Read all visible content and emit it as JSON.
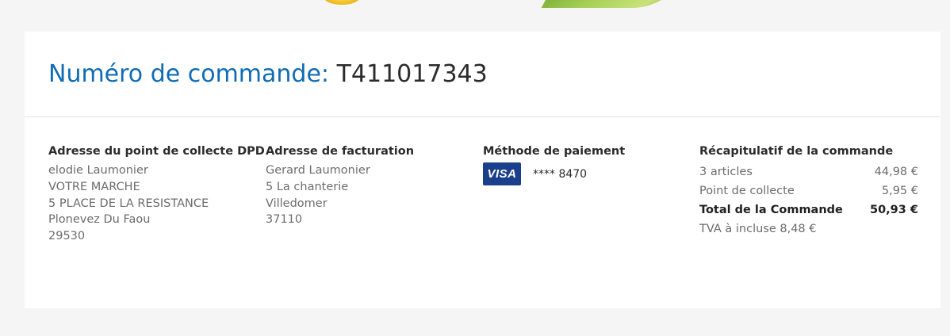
{
  "header": {
    "order_label": "Numéro de commande:",
    "order_number": "T411017343"
  },
  "pickup": {
    "title": "Adresse du point de collecte DPD",
    "lines": [
      "elodie Laumonier",
      "VOTRE MARCHE",
      "5 PLACE DE LA RESISTANCE",
      "Plonevez Du Faou",
      "29530"
    ]
  },
  "billing": {
    "title": "Adresse de facturation",
    "lines": [
      "Gerard Laumonier",
      "5 La chanterie",
      "Villedomer",
      "37110"
    ]
  },
  "payment": {
    "title": "Méthode de paiement",
    "card_brand": "VISA",
    "card_digits": "**** 8470"
  },
  "summary": {
    "title": "Récapitulatif de la commande",
    "rows": [
      {
        "label": "3 articles",
        "value": "44,98 €"
      },
      {
        "label": "Point de collecte",
        "value": "5,95 €"
      }
    ],
    "total": {
      "label": "Total de la Commande",
      "value": "50,93 €"
    },
    "tva": "TVA à incluse 8,48 €"
  },
  "colors": {
    "accent_blue": "#0f6cb4",
    "visa_blue": "#1a3f8b",
    "page_bg": "#f5f5f5"
  }
}
